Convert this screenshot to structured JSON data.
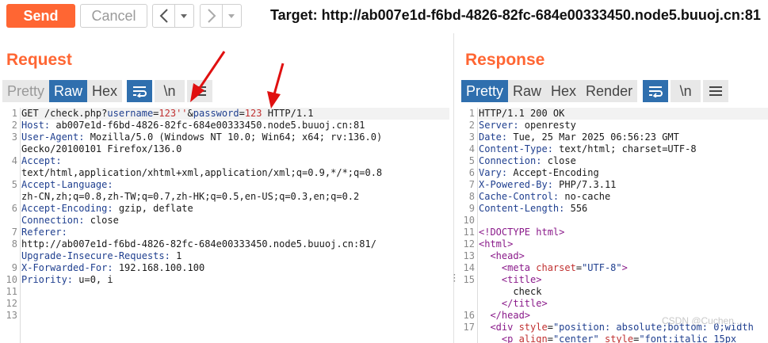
{
  "toolbar": {
    "send_label": "Send",
    "cancel_label": "Cancel",
    "target_text": "Target: http://ab007e1d-f6bd-4826-82fc-684e00333450.node5.buuoj.cn:81"
  },
  "request": {
    "title": "Request",
    "tabs": {
      "pretty": "Pretty",
      "raw": "Raw",
      "hex": "Hex",
      "newline": "\\n"
    },
    "line_numbers": [
      "1",
      "2",
      "3",
      "",
      "4",
      "",
      "5",
      "",
      "6",
      "",
      "7",
      "8",
      "",
      "9",
      "10",
      "11",
      "12",
      "13"
    ],
    "lines": {
      "l1_method": "GET /check.php?",
      "l1_p1": "username",
      "l1_eq1": "=",
      "l1_v1": "123''",
      "l1_amp": "&",
      "l1_p2": "password",
      "l1_eq2": "=",
      "l1_v2": "123",
      "l1_proto": " HTTP/1.1",
      "l2_k": "Host:",
      "l2_v": " ab007e1d-f6bd-4826-82fc-684e00333450.node5.buuoj.cn:81",
      "l3_k": "User-Agent:",
      "l3_v": " Mozilla/5.0 (Windows NT 10.0; Win64; x64; rv:136.0)",
      "l3_cont": "Gecko/20100101 Firefox/136.0",
      "l4_k": "Accept:",
      "l4_cont": "text/html,application/xhtml+xml,application/xml;q=0.9,*/*;q=0.8",
      "l5_k": "Accept-Language:",
      "l5_cont": "zh-CN,zh;q=0.8,zh-TW;q=0.7,zh-HK;q=0.5,en-US;q=0.3,en;q=0.2",
      "l6_k": "Accept-Encoding:",
      "l6_v": " gzip, deflate",
      "l7_k": "Connection:",
      "l7_v": " close",
      "l8_k": "Referer:",
      "l8_cont": "http://ab007e1d-f6bd-4826-82fc-684e00333450.node5.buuoj.cn:81/",
      "l9_k": "Upgrade-Insecure-Requests:",
      "l9_v": " 1",
      "l10_k": "X-Forwarded-For:",
      "l10_v": " 192.168.100.100",
      "l11_k": "Priority:",
      "l11_v": " u=0, i"
    }
  },
  "response": {
    "title": "Response",
    "tabs": {
      "pretty": "Pretty",
      "raw": "Raw",
      "hex": "Hex",
      "render": "Render",
      "newline": "\\n"
    },
    "line_numbers": [
      "1",
      "2",
      "3",
      "4",
      "5",
      "6",
      "7",
      "8",
      "9",
      "10",
      "11",
      "12",
      "13",
      "14",
      "15",
      "",
      "",
      "16",
      "17",
      ""
    ],
    "lines": {
      "l1": "HTTP/1.1 200 OK",
      "l2_k": "Server:",
      "l2_v": " openresty",
      "l3_k": "Date:",
      "l3_v": " Tue, 25 Mar 2025 06:56:23 GMT",
      "l4_k": "Content-Type:",
      "l4_v": " text/html; charset=UTF-8",
      "l5_k": "Connection:",
      "l5_v": " close",
      "l6_k": "Vary:",
      "l6_v": " Accept-Encoding",
      "l7_k": "X-Powered-By:",
      "l7_v": " PHP/7.3.11",
      "l8_k": "Cache-Control:",
      "l8_v": " no-cache",
      "l9_k": "Content-Length:",
      "l9_v": " 556",
      "l11": "<!DOCTYPE html>",
      "l12": "<html>",
      "l13": "  <head>",
      "l14_open": "    <meta ",
      "l14_attr": "charset",
      "l14_eq": "=",
      "l14_val": "\"UTF-8\"",
      "l14_close": ">",
      "l15": "    <title>",
      "l15b": "      check",
      "l15c": "    </title>",
      "l16": "  </head>",
      "l17_open": "  <div ",
      "l17_attr": "style",
      "l17_eq": "=",
      "l17_val": "\"position: absolute;bottom: 0;width",
      "l18_open": "    <p ",
      "l18_attr": "align",
      "l18_eq": "=",
      "l18_val": "\"center\"",
      "l18_sp": " ",
      "l18_attr2": "style",
      "l18_eq2": "=",
      "l18_val2": "\"font:italic 15px"
    }
  },
  "watermark": "CSDN @Cuchen...",
  "colors": {
    "accent": "#ff6633",
    "tab_active": "#2f6fae",
    "arrow": "#e01010"
  },
  "icons": [
    "back-arrow-icon",
    "forward-arrow-icon",
    "dropdown-caret-icon",
    "wrap-lines-icon",
    "menu-icon"
  ]
}
